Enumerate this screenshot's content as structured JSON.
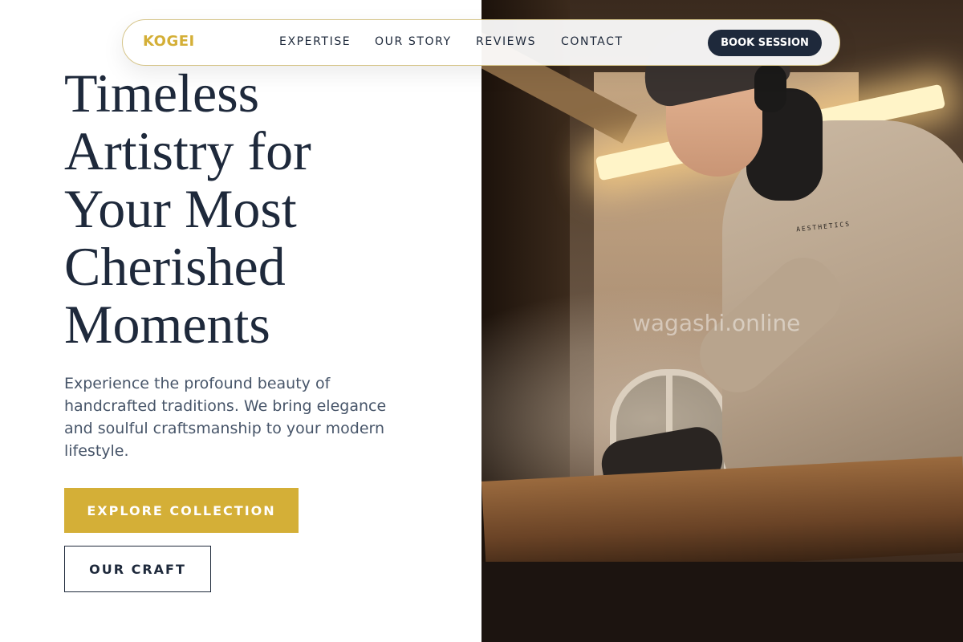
{
  "nav": {
    "logo": "KOGEI",
    "links": [
      "EXPERTISE",
      "OUR STORY",
      "REVIEWS",
      "CONTACT"
    ],
    "cta": "BOOK SESSION"
  },
  "hero": {
    "headline_lines": [
      "Timeless",
      "Artistry for",
      "Your Most",
      "Cherished",
      "Moments"
    ],
    "subtext": "Experience the profound beauty of handcrafted traditions. We bring elegance and soulful craftsmanship to your modern lifestyle.",
    "primary_button": "EXPLORE COLLECTION",
    "secondary_button": "OUR CRAFT",
    "image_watermark": "wagashi.online",
    "shirt_print": "AESTHETICS"
  },
  "colors": {
    "accent": "#d4af37",
    "navy": "#1e293b",
    "body_text": "#475569",
    "background": "#ffffff"
  }
}
